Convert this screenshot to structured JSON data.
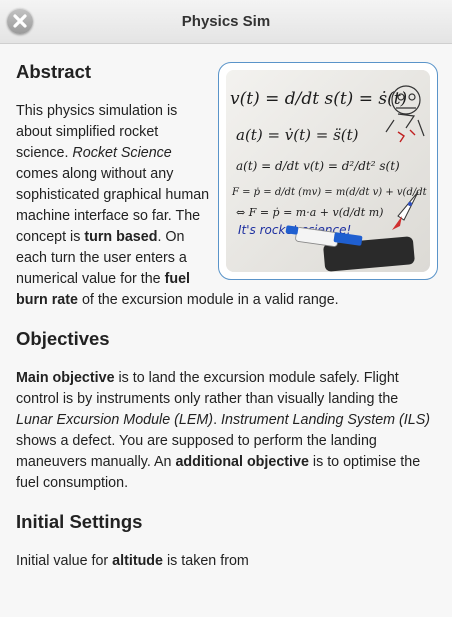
{
  "header": {
    "title": "Physics Sim",
    "close_icon": "close-icon"
  },
  "image": {
    "icon": "rocket-science-whiteboard-image",
    "lines": [
      "v(t) = d/dt s(t) = ṡ(t)",
      "a(t) = v̇(t) = s̈(t)",
      "a(t) = d/dt v(t) = d²/dt² s(t)",
      "F = ṗ = d/dt (mv) = m(d/dt v) + v(d/dt m)",
      "⇔ F = ṗ = m·a + v(d/dt m)",
      "It's rocket science!"
    ]
  },
  "abstract": {
    "heading": "Abstract",
    "t1": "This physics simulation is about simplified rocket science. ",
    "t2": "Rocket Science",
    "t3": " comes along without any sophisticated graphical human machine interface so far. The concept is ",
    "t4": "turn based",
    "t5": ". On each turn the user enters a numerical value for the ",
    "t6": "fuel burn rate",
    "t7": " of the excursion module in a valid range."
  },
  "objectives": {
    "heading": "Objectives",
    "t1": "Main objective",
    "t2": " is to land the excursion module safely. Flight control is by instruments only rather than visually landing the ",
    "t3": "Lunar Excursion Module (LEM)",
    "t4": ". ",
    "t5": "Instrument Landing System (ILS)",
    "t6": " shows a defect. You are supposed to perform the landing maneuvers manually. An ",
    "t7": "additional objective",
    "t8": " is to optimise the fuel consumption."
  },
  "initial": {
    "heading": "Initial Settings",
    "t1": "Initial value for ",
    "t2": "altitude",
    "t3": " is taken from"
  }
}
